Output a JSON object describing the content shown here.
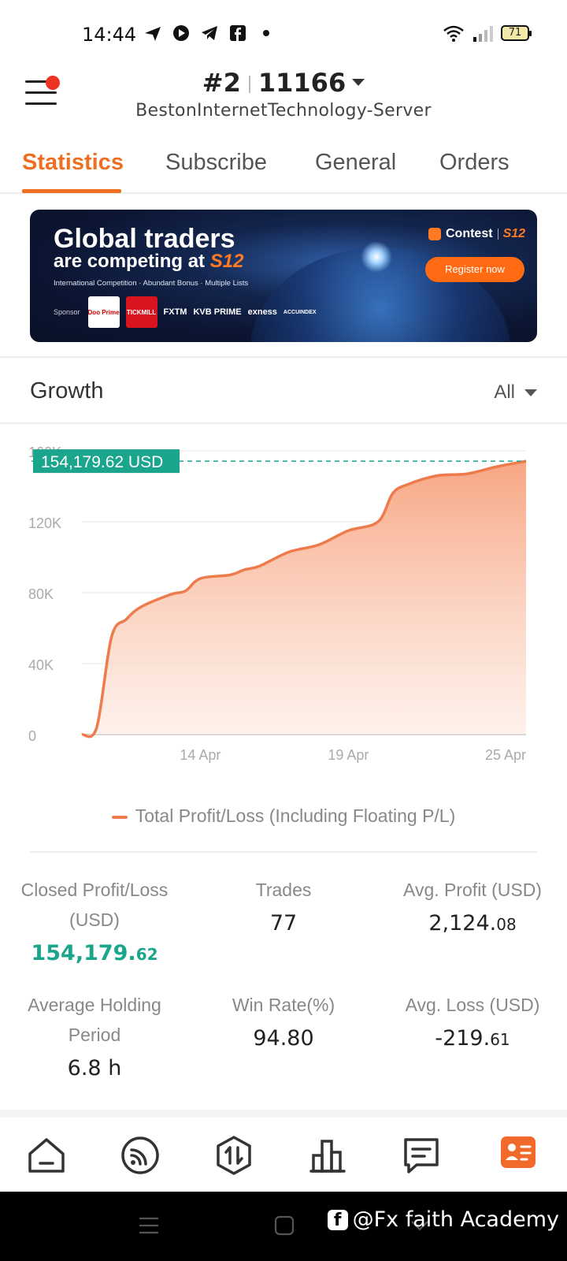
{
  "status": {
    "time": "14:44",
    "battery": "71",
    "left_icons": [
      "send-icon",
      "circle-arrow-icon",
      "telegram-icon",
      "facebook-icon",
      "dot-icon"
    ],
    "right_icons": [
      "wifi-icon",
      "signal-icon",
      "battery-icon"
    ]
  },
  "header": {
    "account_number": "#2",
    "account_id": "11166",
    "server": "BestonInternetTechnology-Server"
  },
  "tabs": [
    "Statistics",
    "Subscribe",
    "General",
    "Orders"
  ],
  "active_tab": "Statistics",
  "banner": {
    "line1": "Global traders",
    "line2": "are competing at",
    "line2_brand": "S12",
    "sub": "International Competition · Abundant Bonus · Multiple Lists",
    "contest_label": "Contest",
    "contest_brand": "S12",
    "register": "Register now",
    "sponsor_label": "Sponsor",
    "sponsors": [
      "Doo Prime",
      "TICKMILL",
      "FXTM",
      "KVB PRIME",
      "exness",
      "ACCUINDEX"
    ]
  },
  "growth": {
    "title": "Growth",
    "filter": "All",
    "current_value_label": "154,179.62 USD",
    "legend": "Total Profit/Loss (Including Floating P/L)"
  },
  "chart_data": {
    "type": "area",
    "y_ticks": [
      "0",
      "40K",
      "80K",
      "120K",
      "160K"
    ],
    "x_ticks": [
      "14 Apr",
      "19 Apr",
      "25 Apr"
    ],
    "ylim": [
      0,
      160000
    ],
    "series": [
      {
        "name": "Total Profit/Loss (Including Floating P/L)",
        "color": "#ee7b4c",
        "x": [
          "10 Apr",
          "10 Apr",
          "11 Apr",
          "11 Apr",
          "12 Apr",
          "13 Apr",
          "13 Apr",
          "14 Apr",
          "15 Apr",
          "15 Apr",
          "16 Apr",
          "17 Apr",
          "18 Apr",
          "19 Apr",
          "20 Apr",
          "20 Apr",
          "21 Apr",
          "22 Apr",
          "23 Apr",
          "24 Apr",
          "25 Apr"
        ],
        "values": [
          0,
          4000,
          55000,
          65000,
          72000,
          79000,
          81000,
          88000,
          90000,
          93000,
          95000,
          103000,
          107000,
          115000,
          120000,
          136000,
          141000,
          146000,
          147000,
          151000,
          154180
        ]
      }
    ]
  },
  "stats": [
    {
      "label": "Closed Profit/Loss (USD)",
      "int": "154,179.",
      "dec": "62",
      "green": true
    },
    {
      "label": "Trades",
      "int": "77",
      "dec": "",
      "green": false
    },
    {
      "label": "Avg. Profit (USD)",
      "int": "2,124.",
      "dec": "08",
      "green": false
    },
    {
      "label": "Average Holding Period",
      "int": "6.8 h",
      "dec": "",
      "green": false
    },
    {
      "label": "Win Rate(%)",
      "int": "94.80",
      "dec": "",
      "green": false
    },
    {
      "label": "Avg. Loss (USD)",
      "int": "-219.",
      "dec": "61",
      "green": false
    }
  ],
  "bottom_nav": [
    "home-icon",
    "feed-icon",
    "trade-icon",
    "chart-icon",
    "message-icon",
    "profile-icon"
  ],
  "watermark": "@Fx faith Academy",
  "colors": {
    "accent": "#ee6f22",
    "green": "#1aa58c",
    "area_line": "#ee7b4c"
  }
}
